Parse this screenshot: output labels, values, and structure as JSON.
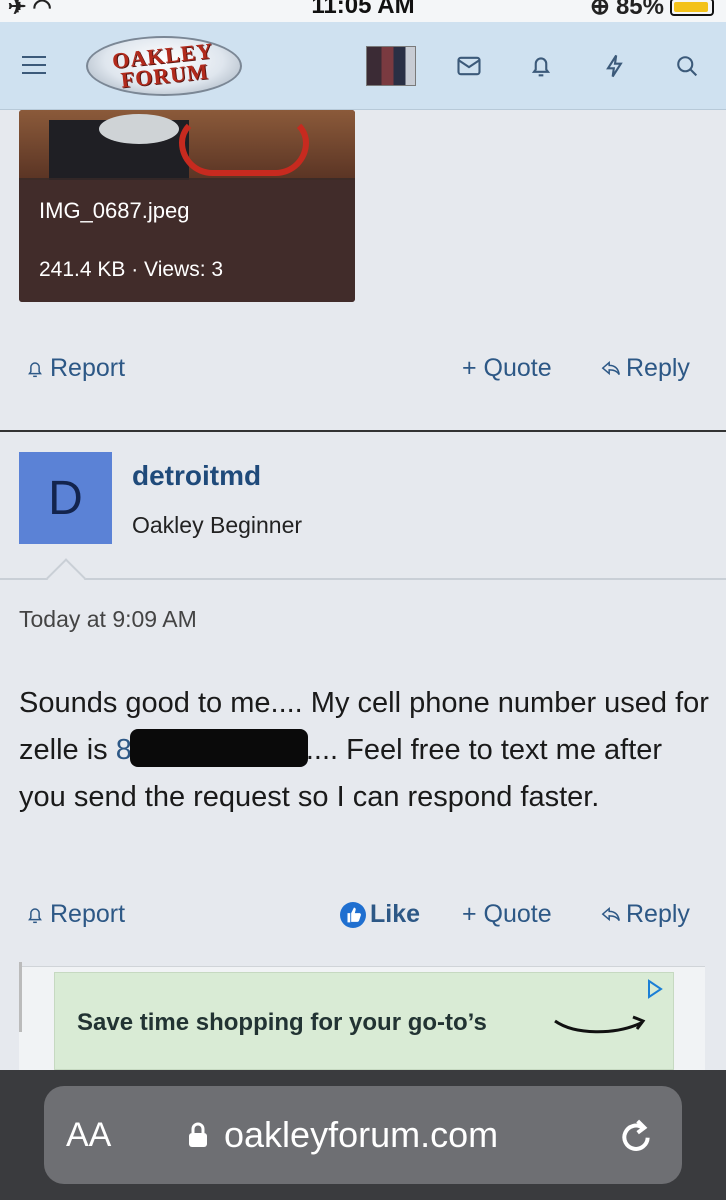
{
  "status_bar": {
    "time": "11:05 AM",
    "battery": "85%",
    "battery_level": 0.85
  },
  "header": {
    "logo_line1": "OAKLEY",
    "logo_line2": "FORUM",
    "icons": [
      "menu-icon",
      "envelope-icon",
      "bell-icon",
      "lightning-icon",
      "search-icon"
    ]
  },
  "attachment": {
    "filename": "IMG_0687.jpeg",
    "meta": "241.4 KB · Views: 3"
  },
  "prev_post_actions": {
    "report": "Report",
    "quote": "+ Quote",
    "reply": "Reply"
  },
  "post": {
    "avatar_letter": "D",
    "username": "detroitmd",
    "user_title": "Oakley Beginner",
    "date": "Today at 9:09 AM",
    "body_1": "Sounds good to me.... My cell phone number used for zelle is ",
    "body_phone_start": "8",
    "body_2": ".... Feel free to text me after you send the request so I can respond faster.",
    "actions": {
      "report": "Report",
      "like": "Like",
      "quote": "+ Quote",
      "reply": "Reply"
    }
  },
  "ad": {
    "text": "Save time shopping for your go-to’s"
  },
  "browser": {
    "aa": "AA",
    "url": "oakleyforum.com"
  },
  "colors": {
    "header_bg": "#cfe1f0",
    "link": "#2d5886",
    "avatar_bg": "#5b82d6",
    "ad_bg": "#d9ebd5"
  }
}
